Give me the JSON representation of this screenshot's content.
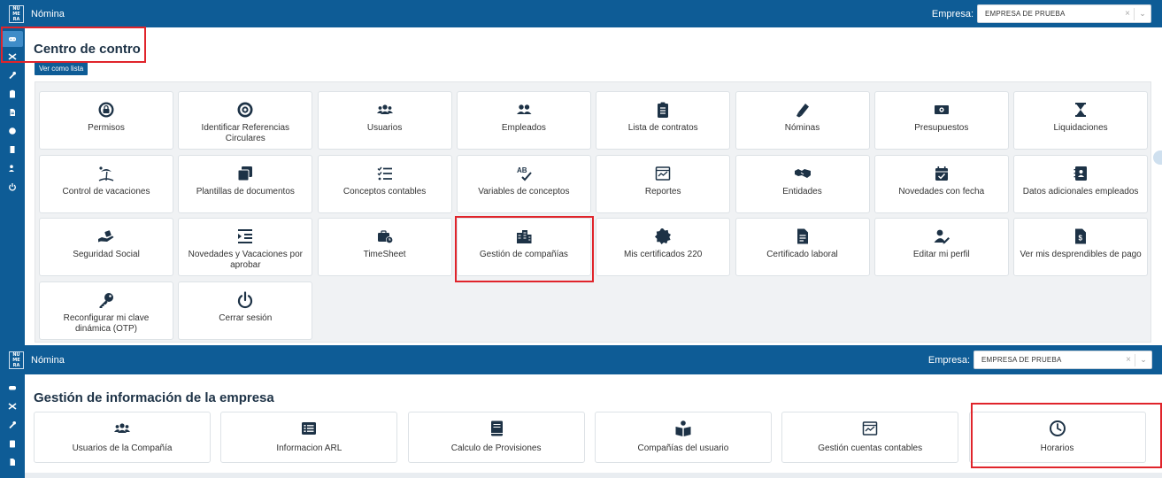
{
  "colors": {
    "brand": "#0e5c96",
    "icon": "#1d3246",
    "highlight": "#e0242b"
  },
  "screen1": {
    "app_title": "Nómina",
    "logo_lines": [
      "NU",
      "ME",
      "RA"
    ],
    "empresa_label": "Empresa:",
    "empresa_value": "EMPRESA DE PRUEBA",
    "page_title": "Centro de contro",
    "list_button": "Ver como lista",
    "sidebar_icons": [
      "gamepad-icon",
      "tools-icon",
      "wrench-icon",
      "clipboard-icon",
      "document-icon",
      "badge-icon",
      "file-icon",
      "user-edit-icon",
      "power-icon"
    ],
    "cards": [
      {
        "label": "Permisos",
        "icon": "lock-icon"
      },
      {
        "label": "Identificar Referencias Circulares",
        "icon": "target-icon"
      },
      {
        "label": "Usuarios",
        "icon": "users-icon"
      },
      {
        "label": "Empleados",
        "icon": "employees-icon"
      },
      {
        "label": "Lista de contratos",
        "icon": "clipboard-list-icon"
      },
      {
        "label": "Nóminas",
        "icon": "highlighter-icon"
      },
      {
        "label": "Presupuestos",
        "icon": "money-icon"
      },
      {
        "label": "Liquidaciones",
        "icon": "hourglass-icon"
      },
      {
        "label": "Control de vacaciones",
        "icon": "beach-icon"
      },
      {
        "label": "Plantillas de documentos",
        "icon": "copy-icon"
      },
      {
        "label": "Conceptos contables",
        "icon": "checklist-icon"
      },
      {
        "label": "Variables de conceptos",
        "icon": "spellcheck-icon"
      },
      {
        "label": "Reportes",
        "icon": "report-icon"
      },
      {
        "label": "Entidades",
        "icon": "handshake-icon"
      },
      {
        "label": "Novedades con fecha",
        "icon": "calendar-check-icon"
      },
      {
        "label": "Datos adicionales empleados",
        "icon": "contact-card-icon"
      },
      {
        "label": "Seguridad Social",
        "icon": "hand-holding-icon"
      },
      {
        "label": "Novedades y Vacaciones por aprobar",
        "icon": "indent-list-icon"
      },
      {
        "label": "TimeSheet",
        "icon": "briefcase-clock-icon"
      },
      {
        "label": "Gestión de compañías",
        "icon": "buildings-icon"
      },
      {
        "label": "Mis certificados 220",
        "icon": "certificate-icon"
      },
      {
        "label": "Certificado laboral",
        "icon": "file-text-icon"
      },
      {
        "label": "Editar mi perfil",
        "icon": "user-pen-icon"
      },
      {
        "label": "Ver mis desprendibles de pago",
        "icon": "file-invoice-icon"
      },
      {
        "label": "Reconfigurar mi clave dinámica (OTP)",
        "icon": "key-icon"
      },
      {
        "label": "Cerrar sesión",
        "icon": "power-off-icon"
      }
    ]
  },
  "screen2": {
    "app_title": "Nómina",
    "logo_lines": [
      "NU",
      "ME",
      "RA"
    ],
    "empresa_label": "Empresa:",
    "empresa_value": "EMPRESA DE PRUEBA",
    "page_title": "Gestión de información de la empresa",
    "sidebar_icons": [
      "gamepad-icon",
      "tools-icon",
      "wrench-icon",
      "clipboard-icon",
      "document-icon"
    ],
    "cards": [
      {
        "label": "Usuarios de la Compañía",
        "icon": "users-icon"
      },
      {
        "label": "Informacion ARL",
        "icon": "list-alt-icon"
      },
      {
        "label": "Calculo de Provisiones",
        "icon": "book-icon"
      },
      {
        "label": "Compañías del usuario",
        "icon": "reader-icon"
      },
      {
        "label": "Gestión cuentas contables",
        "icon": "report-icon"
      },
      {
        "label": "Horarios",
        "icon": "clock-icon"
      }
    ]
  }
}
